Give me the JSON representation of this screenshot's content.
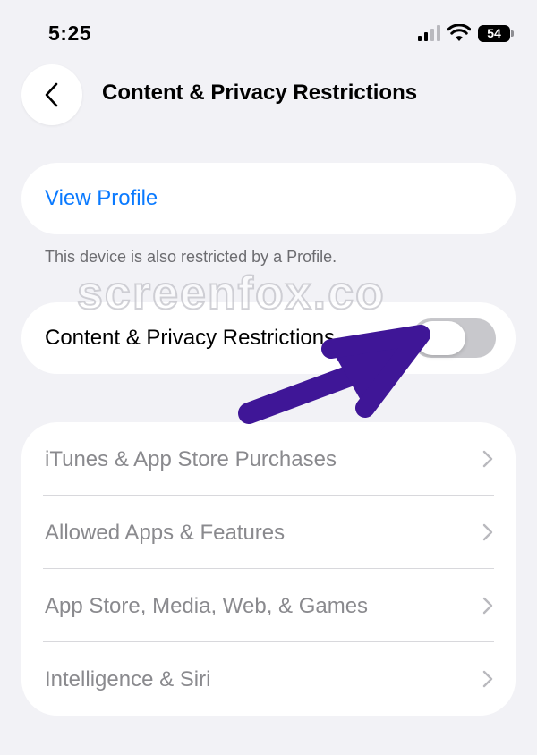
{
  "status_bar": {
    "time": "5:25",
    "battery": "54",
    "icons": [
      "cellular-signal-icon",
      "wifi-icon",
      "battery-icon"
    ]
  },
  "header": {
    "back_icon": "chevron-left-icon",
    "title": "Content & Privacy Restrictions"
  },
  "profile": {
    "link": "View Profile",
    "note": "This device is also restricted by a Profile."
  },
  "watermark": "screenfox.co",
  "restrictions_toggle": {
    "label": "Content & Privacy Restrictions",
    "on": false
  },
  "settings_list": [
    {
      "label": "iTunes & App Store Purchases"
    },
    {
      "label": "Allowed Apps & Features"
    },
    {
      "label": "App Store, Media, Web, & Games"
    },
    {
      "label": "Intelligence & Siri"
    }
  ],
  "colors": {
    "background": "#f2f2f6",
    "link": "#0a7aff",
    "disabled_text": "#8a8a8e",
    "toggle_off": "#c8c8cc",
    "annotation_arrow": "#3f1697"
  }
}
